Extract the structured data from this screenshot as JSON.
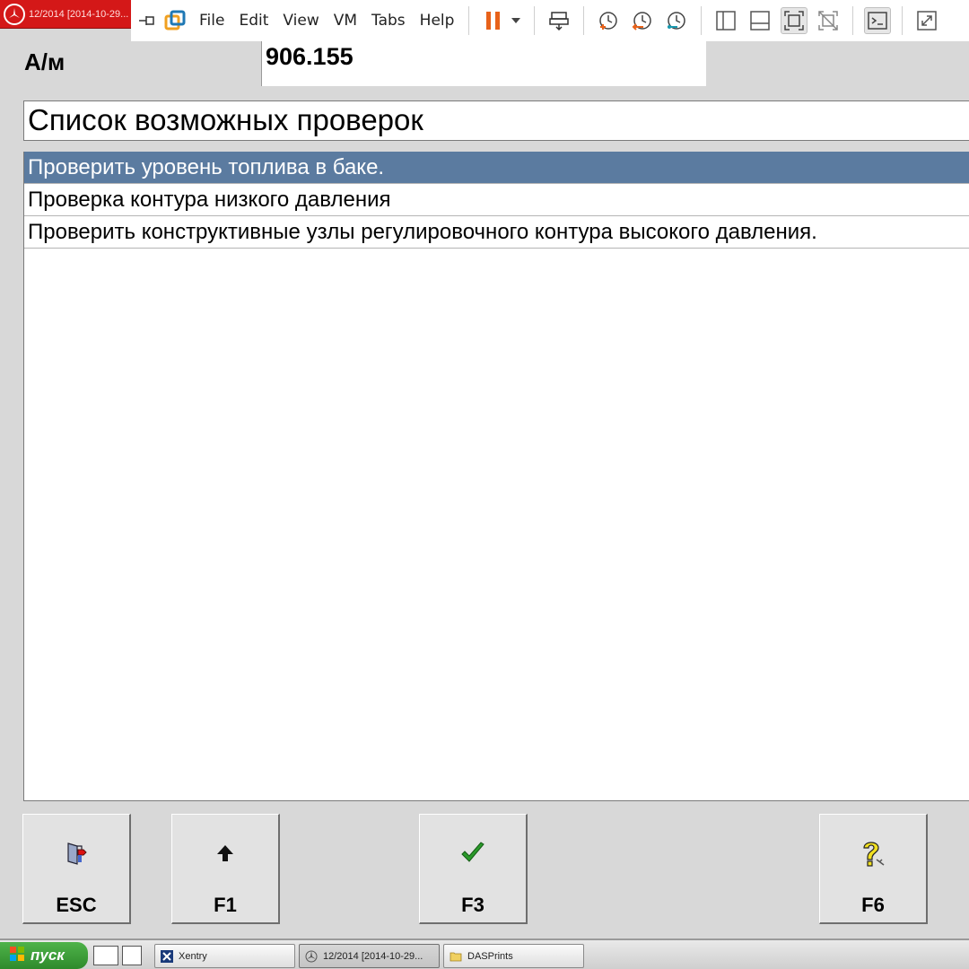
{
  "app_tab": {
    "title": "12/2014 [2014-10-29..."
  },
  "vm_toolbar": {
    "menu": [
      "File",
      "Edit",
      "View",
      "VM",
      "Tabs",
      "Help"
    ],
    "icons": [
      "unpin-icon",
      "vmware-logo-icon",
      "pause-icon",
      "dropdown-arrow-icon",
      "send-keys-icon",
      "snapshot-take-icon",
      "snapshot-revert-icon",
      "snapshot-manager-icon",
      "library-icon",
      "console-only-icon",
      "fullscreen-icon",
      "unity-icon",
      "terminal-icon",
      "stretch-icon"
    ],
    "colors": {
      "pause": "#e8621a",
      "logo_orange": "#f0a020",
      "logo_blue": "#1f78b4",
      "snapshot_orange": "#e8621a",
      "snapshot_teal": "#1a9ab0"
    }
  },
  "unit": {
    "label": "А/м",
    "value": "906.155"
  },
  "list": {
    "title": "Список возможных проверок",
    "items": [
      {
        "text": "Проверить уровень топлива в баке.",
        "selected": true
      },
      {
        "text": "Проверка контура низкого давления",
        "selected": false
      },
      {
        "text": "Проверить конструктивные узлы регулировочного контура высокого давления.",
        "selected": false
      }
    ],
    "selection_color": "#5b7ba0"
  },
  "fkeys": {
    "esc": {
      "label": "ESC",
      "icon": "exit-door-icon"
    },
    "f1": {
      "label": "F1",
      "icon": "arrow-up-icon"
    },
    "f3": {
      "label": "F3",
      "icon": "checkmark-icon"
    },
    "f6": {
      "label": "F6",
      "icon": "help-question-icon"
    }
  },
  "taskbar": {
    "start_label": "пуск",
    "tasks": [
      {
        "label": "Xentry",
        "icon": "xentry-icon"
      },
      {
        "label": "12/2014 [2014-10-29...",
        "icon": "mercedes-star-icon"
      },
      {
        "label": "DASPrints",
        "icon": "folder-icon"
      }
    ]
  }
}
